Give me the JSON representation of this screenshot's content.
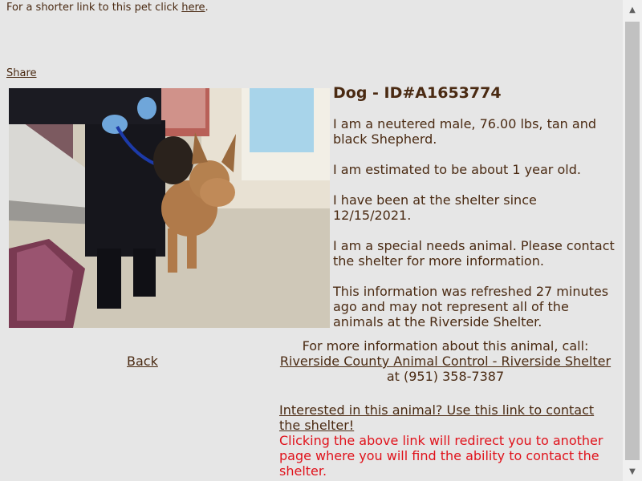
{
  "top": {
    "prefix": "For a shorter link to this pet click ",
    "link": "here",
    "suffix": "."
  },
  "share_label": "Share",
  "photo_alt": "Tan and black Shepherd dog on a leash",
  "pet": {
    "title": "Dog - ID#A1653774",
    "para1": "I am a neutered male, 76.00 lbs, tan and black Shepherd.",
    "para2": "I am estimated to be about 1 year old.",
    "para3": "I have been at the shelter since 12/15/2021.",
    "para4": "I am a special needs animal. Please contact the shelter for more information.",
    "para5": "This information was refreshed 27 minutes ago and may not represent all of the animals at the Riverside Shelter."
  },
  "back_label": "Back",
  "contact": {
    "intro": "For more information about this animal, call:",
    "shelter_link": "Riverside County Animal Control - Riverside Shelter",
    "phone": " at (951) 358-7387"
  },
  "interest": {
    "link": "Interested in this animal? Use this link to contact the shelter!",
    "warning": "Clicking the above link will redirect you to another page where you will find the ability to contact the shelter."
  },
  "scrollbar": {
    "up_icon": "▲",
    "down_icon": "▼"
  }
}
